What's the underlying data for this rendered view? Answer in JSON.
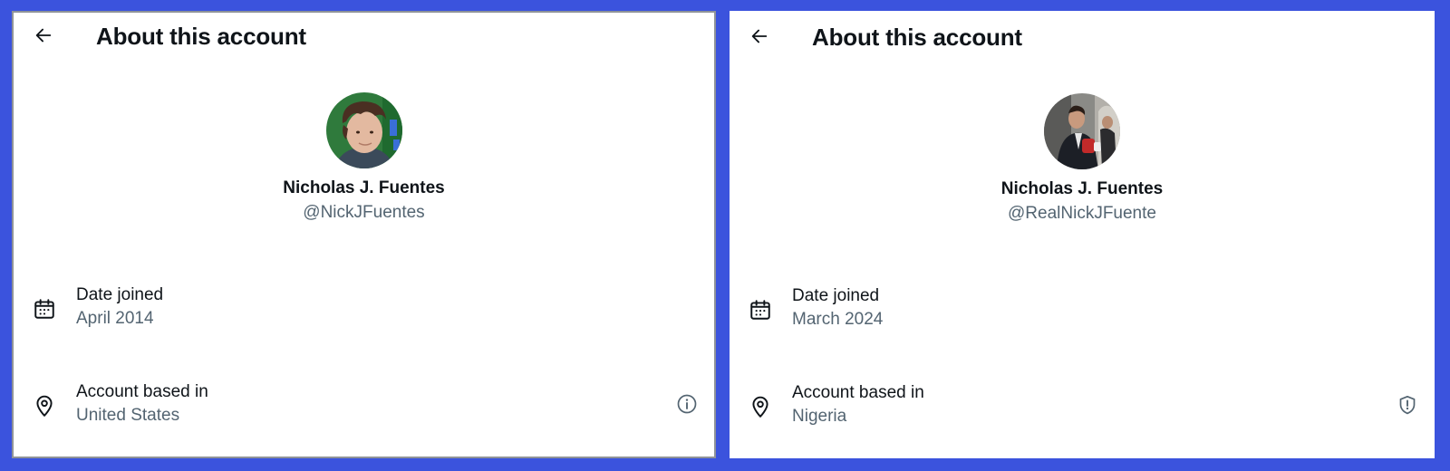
{
  "colors": {
    "background": "#3b53dd",
    "panel": "#ffffff",
    "primary_text": "#0f1419",
    "secondary_text": "#536471"
  },
  "panels": [
    {
      "header": {
        "back_icon": "arrow-left-icon",
        "title": "About this account"
      },
      "profile": {
        "display_name": "Nicholas J. Fuentes",
        "handle": "@NickJFuentes"
      },
      "rows": [
        {
          "icon": "calendar-icon",
          "label": "Date joined",
          "value": "April 2014"
        },
        {
          "icon": "location-pin-icon",
          "label": "Account based in",
          "value": "United States",
          "action_icon": "info-icon"
        }
      ]
    },
    {
      "header": {
        "back_icon": "arrow-left-icon",
        "title": "About this account"
      },
      "profile": {
        "display_name": "Nicholas J. Fuentes",
        "handle": "@RealNickJFuente"
      },
      "rows": [
        {
          "icon": "calendar-icon",
          "label": "Date joined",
          "value": "March 2024"
        },
        {
          "icon": "location-pin-icon",
          "label": "Account based in",
          "value": "Nigeria",
          "action_icon": "shield-alert-icon"
        }
      ]
    }
  ]
}
